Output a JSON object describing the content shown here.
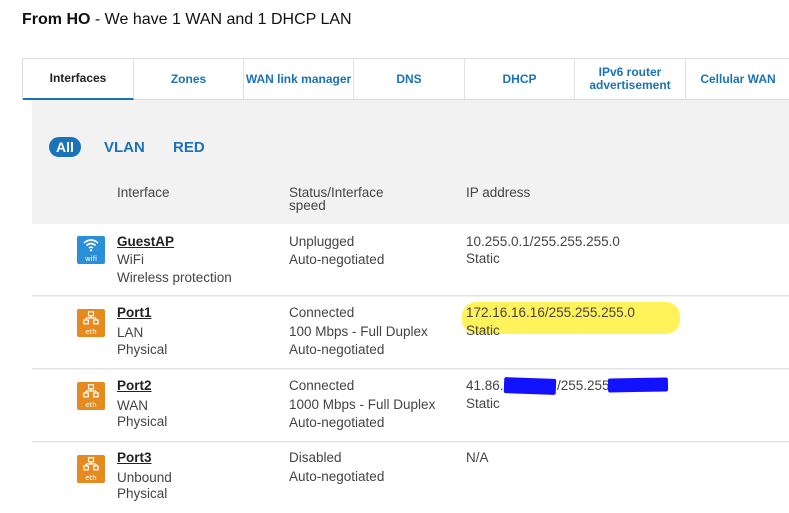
{
  "heading": {
    "bold": "From HO",
    "rest": " - We have 1 WAN and 1 DHCP LAN"
  },
  "tabs": [
    {
      "label": "Interfaces"
    },
    {
      "label": "Zones"
    },
    {
      "label": "WAN link manager"
    },
    {
      "label": "DNS"
    },
    {
      "label": "DHCP"
    },
    {
      "label": "IPv6 router advertisement"
    },
    {
      "label": "Cellular WAN"
    }
  ],
  "filters": {
    "all": "All",
    "vlan": "VLAN",
    "red": "RED"
  },
  "columns": {
    "interface": "Interface",
    "status": "Status/Interface speed",
    "ip": "IP address"
  },
  "rows": [
    {
      "icon": "wifi-icon",
      "icon_label": "wifi",
      "name": "GuestAP",
      "type": "WiFi",
      "kind": "Wireless protection",
      "status": "Unplugged",
      "speed": "Auto-negotiated",
      "negotiation": "",
      "ip": "10.255.0.1/255.255.255.0",
      "ip_mode": "Static"
    },
    {
      "icon": "network-icon",
      "icon_label": "eth",
      "name": "Port1",
      "type": "LAN",
      "kind": "Physical",
      "status": "Connected",
      "speed": "100 Mbps - Full Duplex",
      "negotiation": "Auto-negotiated",
      "ip": "172.16.16.16/255.255.255.0",
      "ip_mode": "Static"
    },
    {
      "icon": "network-icon",
      "icon_label": "eth",
      "name": "Port2",
      "type": "WAN",
      "kind": "Physical",
      "status": "Connected",
      "speed": "1000 Mbps - Full Duplex",
      "negotiation": "Auto-negotiated",
      "ip_part1": "41.86.",
      "ip_part2": "/255.255",
      "ip_mode": "Static"
    },
    {
      "icon": "network-icon",
      "icon_label": "eth",
      "name": "Port3",
      "type": "Unbound",
      "kind": "Physical",
      "status": "Disabled",
      "speed": "Auto-negotiated",
      "negotiation": "",
      "ip": "N/A",
      "ip_mode": ""
    }
  ],
  "colors": {
    "accent": "#1a73b8",
    "highlight": "#fff25a",
    "redaction": "#1212ff",
    "eth_icon": "#e48a1f",
    "wifi_icon": "#2a8fd6"
  }
}
